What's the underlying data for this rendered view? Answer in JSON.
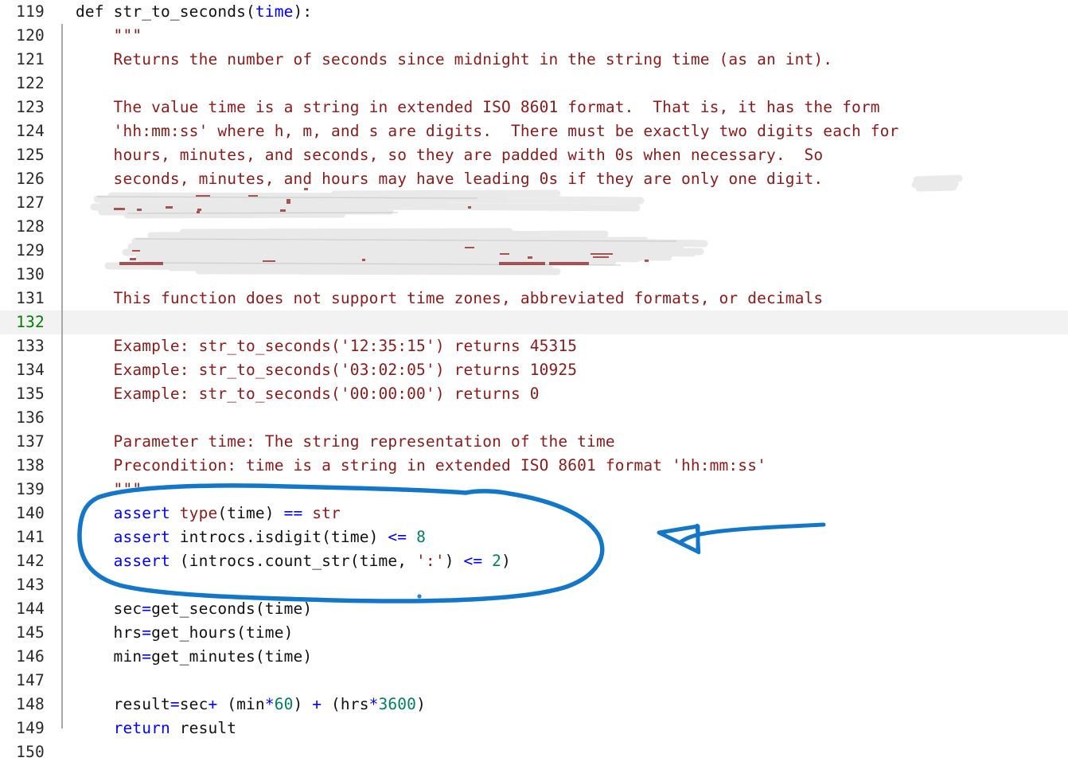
{
  "editor": {
    "language": "python",
    "first_line_number": 119,
    "current_line_number": 132,
    "colors": {
      "background": "#ffffff",
      "line_number": "#2a2a2a",
      "current_line_number": "#008000",
      "current_line_highlight": "#f2f2f2",
      "keyword": "#0000ff",
      "builtin": "#8b1a1a",
      "string": "#8b1a1a",
      "number": "#008060",
      "operator": "#0000ff",
      "plain": "#111111",
      "annotation_ink": "#1277c8",
      "redaction": "#e9e9e9"
    },
    "lines": [
      {
        "n": "119",
        "tokens": [
          {
            "t": "def ",
            "c": "plain"
          },
          {
            "t": "str_to_seconds",
            "c": "plain"
          },
          {
            "t": "(",
            "c": "plain"
          },
          {
            "t": "time",
            "c": "arg"
          },
          {
            "t": "):",
            "c": "plain"
          }
        ]
      },
      {
        "n": "120",
        "tokens": [
          {
            "t": "    \"\"\"",
            "c": "string"
          }
        ]
      },
      {
        "n": "121",
        "tokens": [
          {
            "t": "    Returns the number of seconds since midnight in the string time (as an int).",
            "c": "string"
          }
        ]
      },
      {
        "n": "122",
        "tokens": [
          {
            "t": "",
            "c": "plain"
          }
        ]
      },
      {
        "n": "123",
        "tokens": [
          {
            "t": "    The value time is a string in extended ISO 8601 format.  That is, it has the form",
            "c": "string"
          }
        ]
      },
      {
        "n": "124",
        "tokens": [
          {
            "t": "    'hh:mm:ss' where h, m, and s are digits.  There must be exactly two digits each for",
            "c": "string"
          }
        ]
      },
      {
        "n": "125",
        "tokens": [
          {
            "t": "    hours, minutes, and seconds, so they are padded with 0s when necessary.  So",
            "c": "string"
          }
        ]
      },
      {
        "n": "126",
        "tokens": [
          {
            "t": "    seconds, minutes, and hours may have leading 0s if they are only one digit.",
            "c": "string"
          }
        ]
      },
      {
        "n": "127",
        "tokens": [
          {
            "t": "",
            "c": "string"
          }
        ]
      },
      {
        "n": "128",
        "tokens": [
          {
            "t": "",
            "c": "string"
          }
        ]
      },
      {
        "n": "129",
        "tokens": [
          {
            "t": "",
            "c": "string"
          }
        ]
      },
      {
        "n": "130",
        "tokens": [
          {
            "t": "",
            "c": "string"
          }
        ]
      },
      {
        "n": "131",
        "tokens": [
          {
            "t": "    This function does not support time zones, abbreviated formats, or decimals",
            "c": "string"
          }
        ]
      },
      {
        "n": "132",
        "tokens": [
          {
            "t": "",
            "c": "plain"
          }
        ],
        "current": true
      },
      {
        "n": "133",
        "tokens": [
          {
            "t": "    Example: str_to_seconds('12:35:15') returns 45315",
            "c": "string"
          }
        ]
      },
      {
        "n": "134",
        "tokens": [
          {
            "t": "    Example: str_to_seconds('03:02:05') returns 10925",
            "c": "string"
          }
        ]
      },
      {
        "n": "135",
        "tokens": [
          {
            "t": "    Example: str_to_seconds('00:00:00') returns 0",
            "c": "string"
          }
        ]
      },
      {
        "n": "136",
        "tokens": [
          {
            "t": "",
            "c": "plain"
          }
        ]
      },
      {
        "n": "137",
        "tokens": [
          {
            "t": "    Parameter time: The string representation of the time",
            "c": "string"
          }
        ]
      },
      {
        "n": "138",
        "tokens": [
          {
            "t": "    Precondition: time is a string in extended ISO 8601 format 'hh:mm:ss'",
            "c": "string"
          }
        ]
      },
      {
        "n": "139",
        "tokens": [
          {
            "t": "    \"\"\"",
            "c": "string"
          }
        ]
      },
      {
        "n": "140",
        "tokens": [
          {
            "t": "    ",
            "c": "plain"
          },
          {
            "t": "assert",
            "c": "keyword"
          },
          {
            "t": " ",
            "c": "plain"
          },
          {
            "t": "type",
            "c": "builtin"
          },
          {
            "t": "(time) ",
            "c": "plain"
          },
          {
            "t": "==",
            "c": "operator"
          },
          {
            "t": " ",
            "c": "plain"
          },
          {
            "t": "str",
            "c": "builtin"
          }
        ]
      },
      {
        "n": "141",
        "tokens": [
          {
            "t": "    ",
            "c": "plain"
          },
          {
            "t": "assert",
            "c": "keyword"
          },
          {
            "t": " introcs.isdigit(time) ",
            "c": "plain"
          },
          {
            "t": "<=",
            "c": "operator"
          },
          {
            "t": " ",
            "c": "plain"
          },
          {
            "t": "8",
            "c": "number"
          }
        ]
      },
      {
        "n": "142",
        "tokens": [
          {
            "t": "    ",
            "c": "plain"
          },
          {
            "t": "assert",
            "c": "keyword"
          },
          {
            "t": " (introcs.count_str(time, ",
            "c": "plain"
          },
          {
            "t": "':'",
            "c": "string"
          },
          {
            "t": ") ",
            "c": "plain"
          },
          {
            "t": "<=",
            "c": "operator"
          },
          {
            "t": " ",
            "c": "plain"
          },
          {
            "t": "2",
            "c": "number"
          },
          {
            "t": ")",
            "c": "plain"
          }
        ]
      },
      {
        "n": "143",
        "tokens": [
          {
            "t": "",
            "c": "plain"
          }
        ]
      },
      {
        "n": "144",
        "tokens": [
          {
            "t": "    sec",
            "c": "plain"
          },
          {
            "t": "=",
            "c": "operator"
          },
          {
            "t": "get_seconds(time)",
            "c": "plain"
          }
        ]
      },
      {
        "n": "145",
        "tokens": [
          {
            "t": "    hrs",
            "c": "plain"
          },
          {
            "t": "=",
            "c": "operator"
          },
          {
            "t": "get_hours(time)",
            "c": "plain"
          }
        ]
      },
      {
        "n": "146",
        "tokens": [
          {
            "t": "    min",
            "c": "plain"
          },
          {
            "t": "=",
            "c": "operator"
          },
          {
            "t": "get_minutes(time)",
            "c": "plain"
          }
        ]
      },
      {
        "n": "147",
        "tokens": [
          {
            "t": "",
            "c": "plain"
          }
        ]
      },
      {
        "n": "148",
        "tokens": [
          {
            "t": "    result",
            "c": "plain"
          },
          {
            "t": "=",
            "c": "operator"
          },
          {
            "t": "sec",
            "c": "plain"
          },
          {
            "t": "+",
            "c": "operator"
          },
          {
            "t": " (min",
            "c": "plain"
          },
          {
            "t": "*",
            "c": "operator"
          },
          {
            "t": "60",
            "c": "number"
          },
          {
            "t": ") ",
            "c": "plain"
          },
          {
            "t": "+",
            "c": "operator"
          },
          {
            "t": " (hrs",
            "c": "plain"
          },
          {
            "t": "*",
            "c": "operator"
          },
          {
            "t": "3600",
            "c": "number"
          },
          {
            "t": ")",
            "c": "plain"
          }
        ]
      },
      {
        "n": "149",
        "tokens": [
          {
            "t": "    ",
            "c": "plain"
          },
          {
            "t": "return",
            "c": "keyword"
          },
          {
            "t": " result",
            "c": "plain"
          }
        ]
      },
      {
        "n": "150",
        "tokens": [
          {
            "t": "",
            "c": "plain"
          }
        ]
      }
    ]
  },
  "annotations": {
    "ellipse": {
      "label": "hand-drawn-blue-ellipse-around-assert-block",
      "encircles_lines": [
        "140",
        "141",
        "142"
      ]
    },
    "arrow": {
      "label": "hand-drawn-blue-arrow-pointing-left-at-assert-block",
      "direction": "left"
    },
    "dot": {
      "label": "stray-blue-ink-dot"
    },
    "redactions": [
      {
        "label": "scribbled-out-docstring-line-126-tail"
      },
      {
        "label": "scribbled-out-docstring-line-127"
      },
      {
        "label": "scribbled-out-docstring-lines-128-130"
      }
    ]
  }
}
